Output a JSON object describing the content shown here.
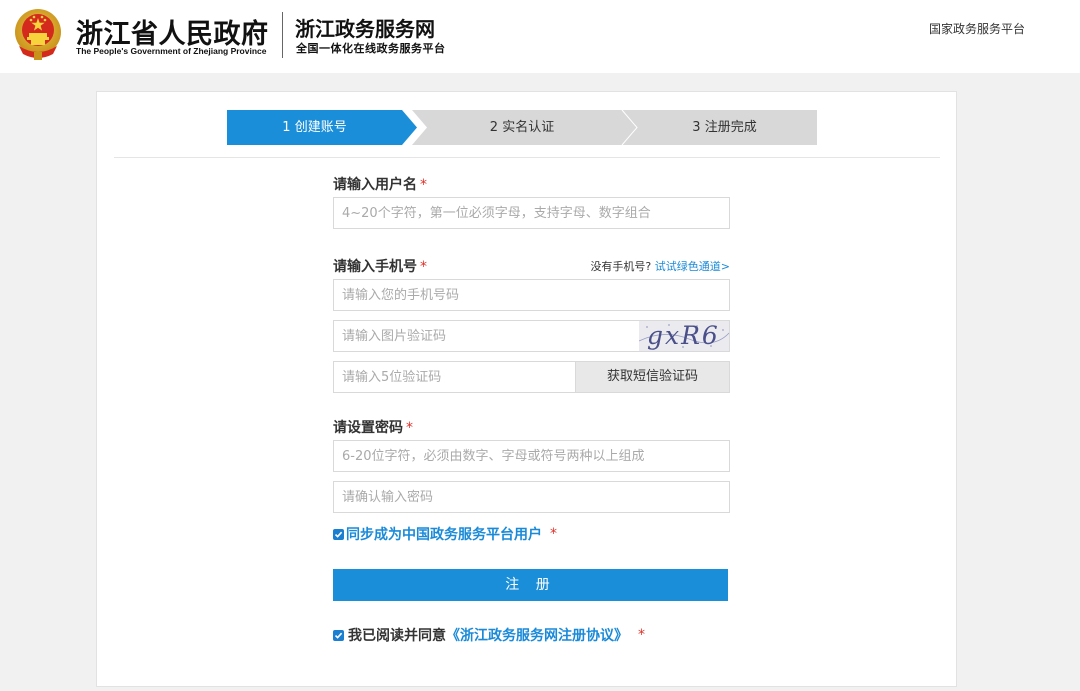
{
  "header": {
    "gov_name_cn": "浙江省人民政府",
    "gov_name_en": "The People's Government of Zhejiang Province",
    "site_name": "浙江政务服务网",
    "site_slogan": "全国一体化在线政务服务平台",
    "national_platform_link": "国家政务服务平台",
    "emblem_icon": "national-emblem-icon"
  },
  "steps": [
    {
      "label": "1 创建账号",
      "active": true
    },
    {
      "label": "2 实名认证",
      "active": false
    },
    {
      "label": "3 注册完成",
      "active": false
    }
  ],
  "form": {
    "username": {
      "label": "请输入用户名",
      "required_mark": "*",
      "placeholder": "4~20个字符，第一位必须字母，支持字母、数字组合",
      "value": ""
    },
    "phone": {
      "label": "请输入手机号",
      "required_mark": "*",
      "no_phone_text": "没有手机号?",
      "green_channel_link": "试试绿色通道>",
      "placeholder": "请输入您的手机号码",
      "value": ""
    },
    "image_code": {
      "placeholder": "请输入图片验证码",
      "value": "",
      "captcha_text": "gxR6"
    },
    "sms_code": {
      "placeholder": "请输入5位验证码",
      "value": "",
      "button_label": "获取短信验证码"
    },
    "password": {
      "label": "请设置密码",
      "required_mark": "*",
      "placeholder": "6-20位字符，必须由数字、字母或符号两种以上组成",
      "value": ""
    },
    "confirm_password": {
      "placeholder": "请确认输入密码",
      "value": ""
    },
    "sync_checkbox": {
      "label": "同步成为中国政务服务平台用户",
      "required_mark": "*",
      "checked": true
    },
    "submit_label": "注 册",
    "agree_checkbox": {
      "prefix": "我已阅读并同意",
      "link_text": "《浙江政务服务网注册协议》",
      "required_mark": "*",
      "checked": true
    }
  },
  "colors": {
    "accent": "#1a8ed8",
    "step_active": "#1a8ed8",
    "step_inactive": "#d8d8d8",
    "required": "#e0312a",
    "page_bg": "#f1f1f1"
  }
}
